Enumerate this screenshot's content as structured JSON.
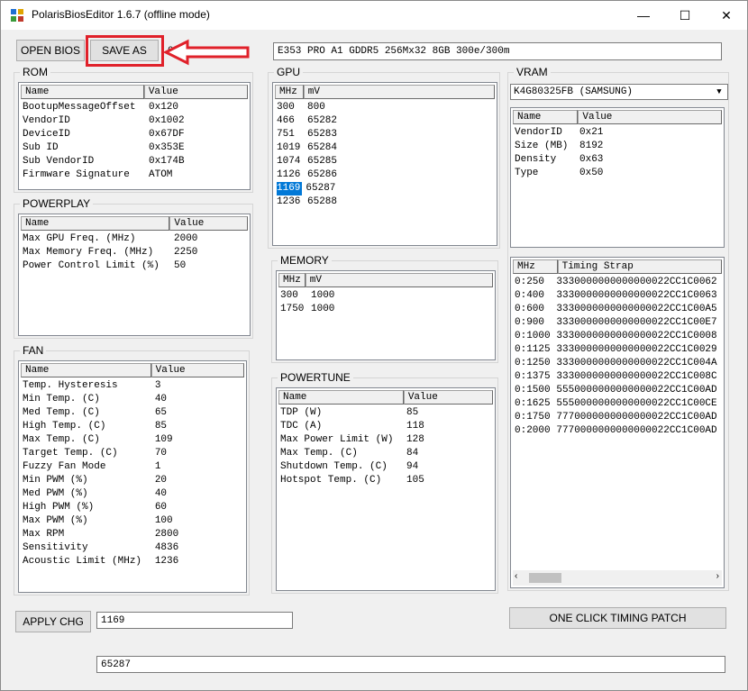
{
  "window": {
    "title": "PolarisBiosEditor 1.6.7 (offline mode)",
    "minimize_glyph": "—",
    "maximize_glyph": "☐",
    "close_glyph": "✕"
  },
  "toolbar": {
    "open_label": "OPEN BIOS",
    "save_label": "SAVE AS",
    "partial_text": "0",
    "bios_info": "E353 PRO A1 GDDR5 256Mx32 8GB 300e/300m"
  },
  "rom": {
    "title": "ROM",
    "headers": [
      "Name",
      "Value"
    ],
    "rows": [
      [
        "BootupMessageOffset",
        "0x120"
      ],
      [
        "VendorID",
        "0x1002"
      ],
      [
        "DeviceID",
        "0x67DF"
      ],
      [
        "Sub ID",
        "0x353E"
      ],
      [
        "Sub VendorID",
        "0x174B"
      ],
      [
        "Firmware Signature",
        "ATOM"
      ]
    ]
  },
  "powerplay": {
    "title": "POWERPLAY",
    "headers": [
      "Name",
      "Value"
    ],
    "rows": [
      [
        "Max GPU Freq. (MHz)",
        "2000"
      ],
      [
        "Max Memory Freq. (MHz)",
        "2250"
      ],
      [
        "Power Control Limit (%)",
        "50"
      ]
    ]
  },
  "fan": {
    "title": "FAN",
    "headers": [
      "Name",
      "Value"
    ],
    "rows": [
      [
        "Temp. Hysteresis",
        "3"
      ],
      [
        "Min Temp. (C)",
        "40"
      ],
      [
        "Med Temp. (C)",
        "65"
      ],
      [
        "High Temp. (C)",
        "85"
      ],
      [
        "Max Temp. (C)",
        "109"
      ],
      [
        "Target Temp. (C)",
        "70"
      ],
      [
        "Fuzzy Fan Mode",
        "1"
      ],
      [
        "Min PWM (%)",
        "20"
      ],
      [
        "Med PWM (%)",
        "40"
      ],
      [
        "High PWM (%)",
        "60"
      ],
      [
        "Max PWM (%)",
        "100"
      ],
      [
        "Max RPM",
        "2800"
      ],
      [
        "Sensitivity",
        "4836"
      ],
      [
        "Acoustic Limit (MHz)",
        "1236"
      ]
    ]
  },
  "gpu": {
    "title": "GPU",
    "headers": [
      "MHz",
      "mV"
    ],
    "rows": [
      [
        "300",
        "800"
      ],
      [
        "466",
        "65282"
      ],
      [
        "751",
        "65283"
      ],
      [
        "1019",
        "65284"
      ],
      [
        "1074",
        "65285"
      ],
      [
        "1126",
        "65286"
      ],
      [
        "1169",
        "65287"
      ],
      [
        "1236",
        "65288"
      ]
    ],
    "selected_index": 6
  },
  "memory": {
    "title": "MEMORY",
    "headers": [
      "MHz",
      "mV"
    ],
    "rows": [
      [
        "300",
        "1000"
      ],
      [
        "1750",
        "1000"
      ]
    ]
  },
  "powertune": {
    "title": "POWERTUNE",
    "headers": [
      "Name",
      "Value"
    ],
    "rows": [
      [
        "TDP (W)",
        "85"
      ],
      [
        "TDC (A)",
        "118"
      ],
      [
        "Max Power Limit (W)",
        "128"
      ],
      [
        "Max Temp. (C)",
        "84"
      ],
      [
        "Shutdown Temp. (C)",
        "94"
      ],
      [
        "Hotspot Temp. (C)",
        "105"
      ]
    ]
  },
  "vram": {
    "title": "VRAM",
    "combo_value": "K4G80325FB (SAMSUNG)",
    "headers": [
      "Name",
      "Value"
    ],
    "rows": [
      [
        "VendorID",
        "0x21"
      ],
      [
        "Size (MB)",
        "8192"
      ],
      [
        "Density",
        "0x63"
      ],
      [
        "Type",
        "0x50"
      ]
    ]
  },
  "timing": {
    "headers": [
      "MHz",
      "Timing Strap"
    ],
    "rows": [
      [
        "0:250",
        "3330000000000000022CC1C0062"
      ],
      [
        "0:400",
        "3330000000000000022CC1C0063"
      ],
      [
        "0:600",
        "3330000000000000022CC1C00A5"
      ],
      [
        "0:900",
        "3330000000000000022CC1C00E7"
      ],
      [
        "0:1000",
        "3330000000000000022CC1C0008"
      ],
      [
        "0:1125",
        "3330000000000000022CC1C0029"
      ],
      [
        "0:1250",
        "3330000000000000022CC1C004A"
      ],
      [
        "0:1375",
        "3330000000000000022CC1C008C"
      ],
      [
        "0:1500",
        "5550000000000000022CC1C00AD"
      ],
      [
        "0:1625",
        "5550000000000000022CC1C00CE"
      ],
      [
        "0:1750",
        "7770000000000000022CC1C00AD"
      ],
      [
        "0:2000",
        "7770000000000000022CC1C00AD"
      ]
    ]
  },
  "bottom": {
    "apply_label": "APPLY CHG",
    "edit_value": "1169",
    "timing_patch_label": "ONE CLICK TIMING PATCH",
    "value_field": "65287"
  },
  "colors": {
    "annotation": "#e0212a",
    "selection": "#0078d7"
  }
}
